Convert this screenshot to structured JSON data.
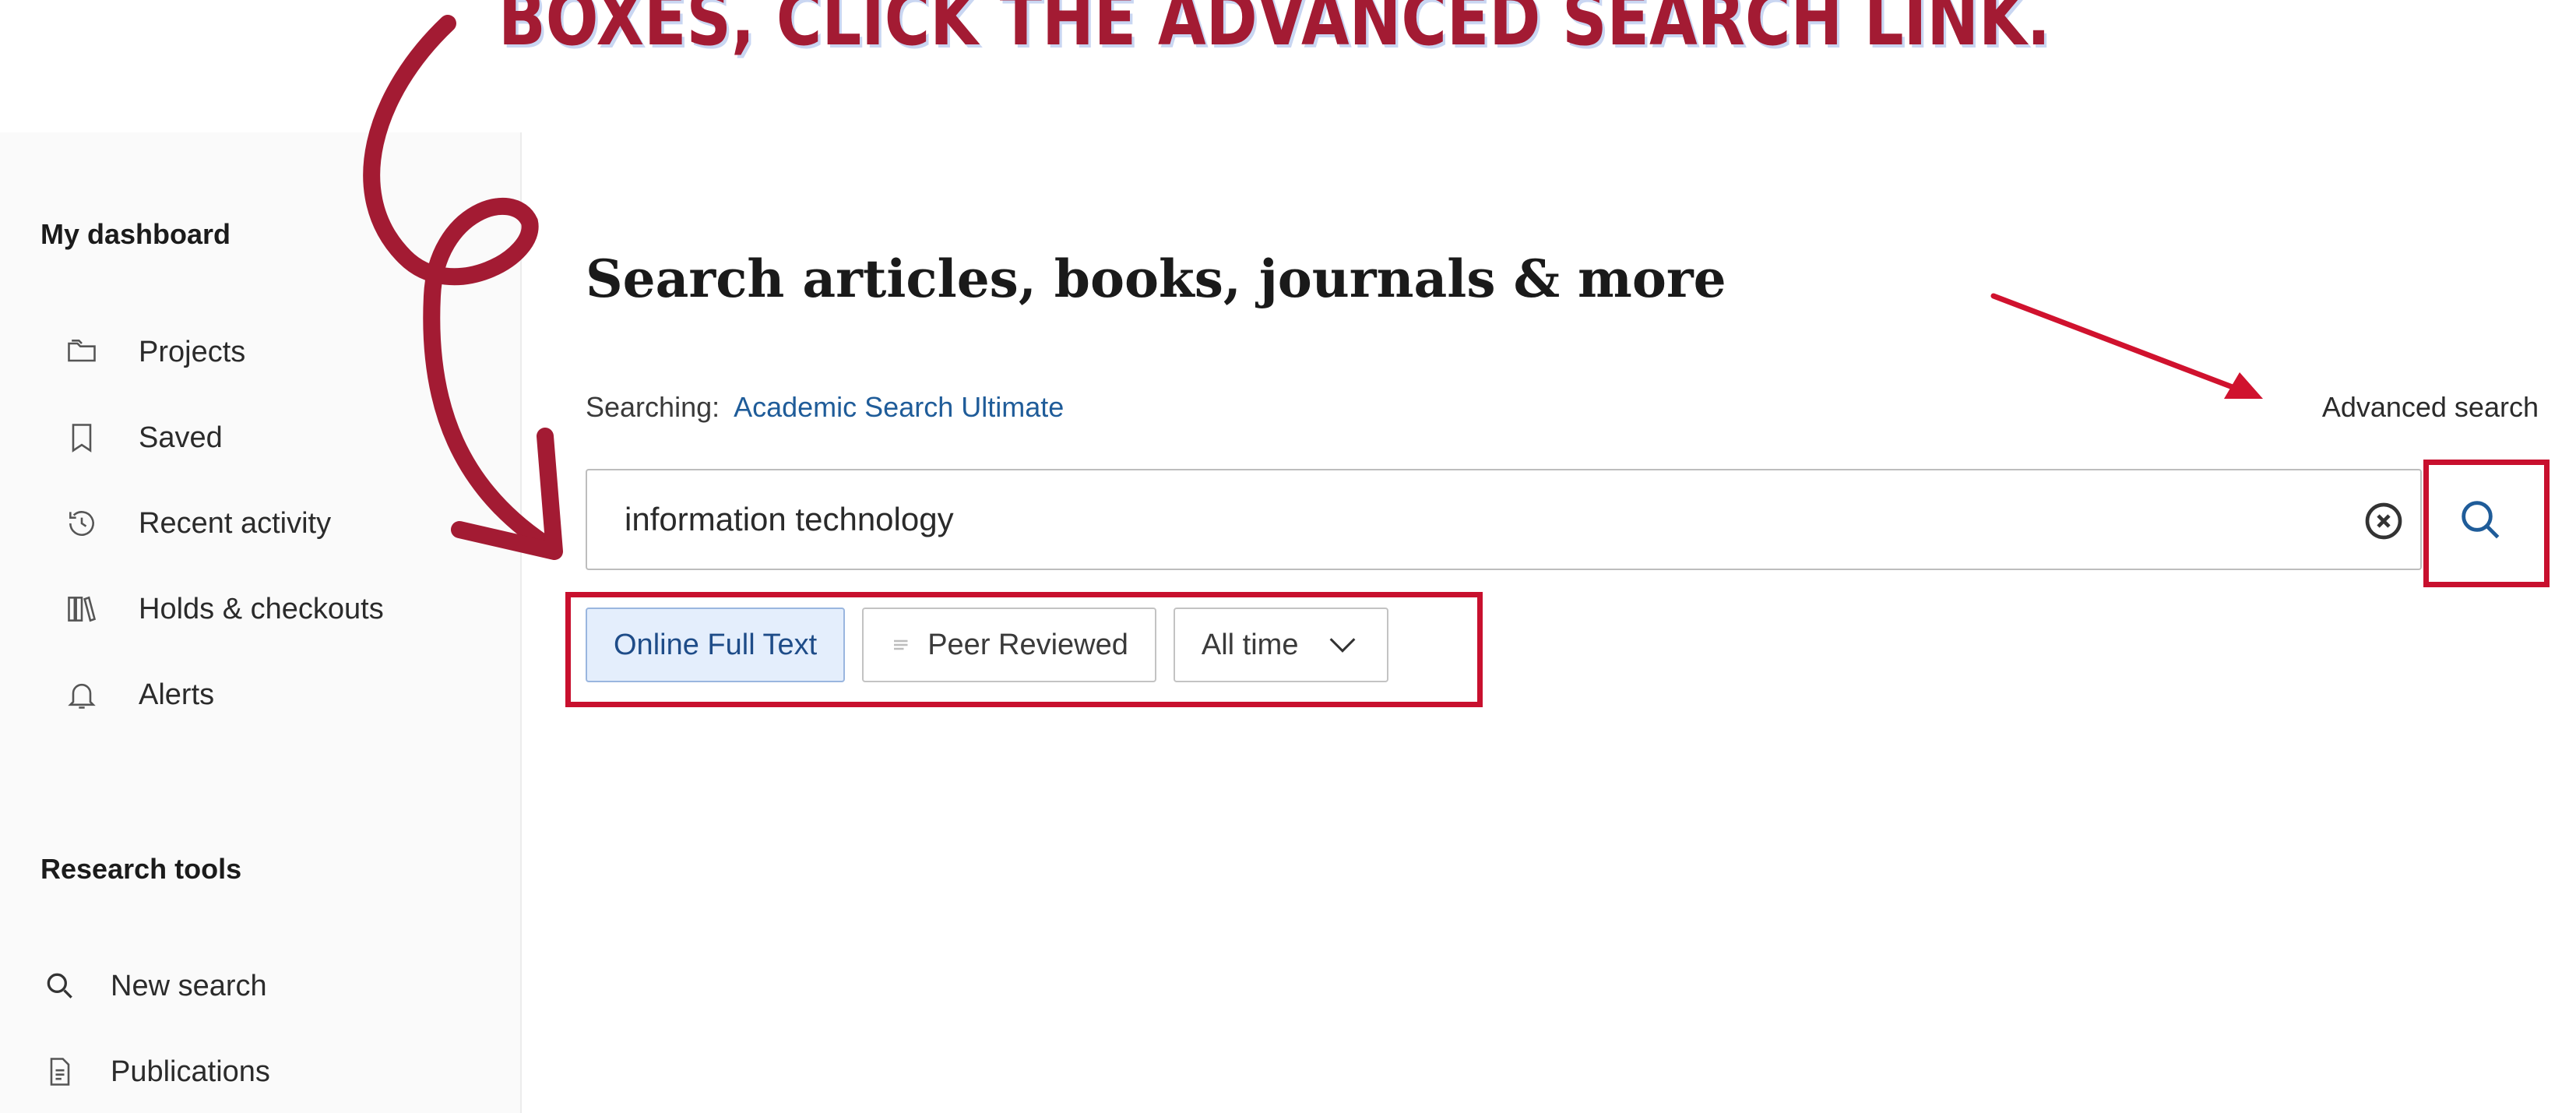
{
  "banner": {
    "text": "BOXES, CLICK THE ADVANCED SEARCH LINK."
  },
  "sidebar": {
    "dashboard_heading": "My dashboard",
    "dashboard_items": [
      {
        "label": "Projects",
        "icon": "folder-icon"
      },
      {
        "label": "Saved",
        "icon": "bookmark-icon"
      },
      {
        "label": "Recent activity",
        "icon": "history-icon"
      },
      {
        "label": "Holds & checkouts",
        "icon": "library-books-icon"
      },
      {
        "label": "Alerts",
        "icon": "bell-icon"
      }
    ],
    "tools_heading": "Research tools",
    "tools_items": [
      {
        "label": "New search",
        "icon": "search-icon"
      },
      {
        "label": "Publications",
        "icon": "document-icon"
      }
    ]
  },
  "main": {
    "title": "Search articles, books, journals & more",
    "searching_label": "Searching:",
    "database_name": "Academic Search Ultimate",
    "advanced_search_label": "Advanced search",
    "search": {
      "value": "information technology"
    },
    "filters": {
      "full_text": "Online Full Text",
      "peer_reviewed": "Peer Reviewed",
      "date_range": "All time"
    }
  },
  "colors": {
    "annotation_red": "#a31b33",
    "highlight_red": "#c8102e",
    "link_blue": "#1f5c99",
    "active_chip_bg": "#e4eefc"
  }
}
